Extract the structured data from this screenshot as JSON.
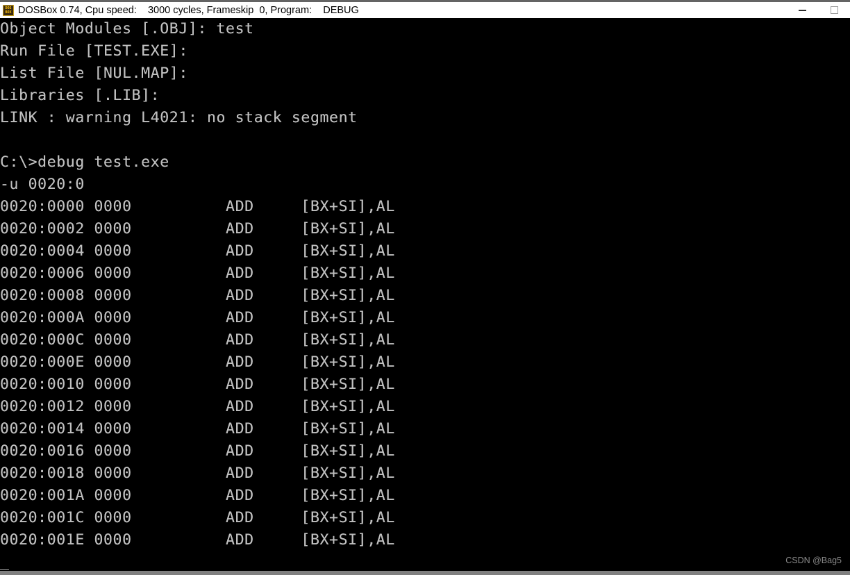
{
  "window": {
    "titlebar": {
      "icon_name": "dosbox-app-icon",
      "icon_line1": "DOS",
      "icon_line2": "BOX",
      "title": "DOSBox 0.74, Cpu speed:    3000 cycles, Frameskip  0, Program:    DEBUG",
      "minimize_label": "Minimize",
      "maximize_label": "Maximize"
    },
    "background_color": "#000000",
    "titlebar_color": "#ffffff",
    "terminal_text_color": "#c0c0c0"
  },
  "terminal": {
    "lines": [
      "Object Modules [.OBJ]: test",
      "Run File [TEST.EXE]:",
      "List File [NUL.MAP]:",
      "Libraries [.LIB]:",
      "LINK : warning L4021: no stack segment",
      "",
      "C:\\>debug test.exe",
      "-u 0020:0",
      "0020:0000 0000          ADD     [BX+SI],AL",
      "0020:0002 0000          ADD     [BX+SI],AL",
      "0020:0004 0000          ADD     [BX+SI],AL",
      "0020:0006 0000          ADD     [BX+SI],AL",
      "0020:0008 0000          ADD     [BX+SI],AL",
      "0020:000A 0000          ADD     [BX+SI],AL",
      "0020:000C 0000          ADD     [BX+SI],AL",
      "0020:000E 0000          ADD     [BX+SI],AL",
      "0020:0010 0000          ADD     [BX+SI],AL",
      "0020:0012 0000          ADD     [BX+SI],AL",
      "0020:0014 0000          ADD     [BX+SI],AL",
      "0020:0016 0000          ADD     [BX+SI],AL",
      "0020:0018 0000          ADD     [BX+SI],AL",
      "0020:001A 0000          ADD     [BX+SI],AL",
      "0020:001C 0000          ADD     [BX+SI],AL",
      "0020:001E 0000          ADD     [BX+SI],AL"
    ],
    "cursor": "_"
  },
  "watermark": {
    "text": "CSDN @Bag5"
  }
}
